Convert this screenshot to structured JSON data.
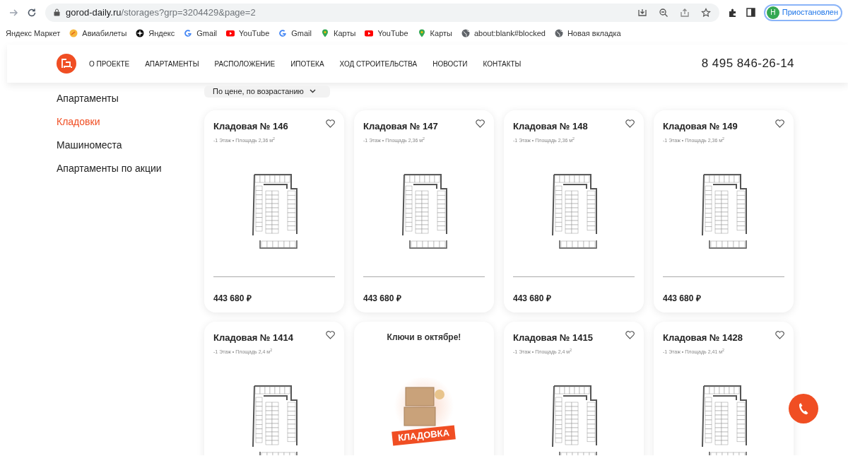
{
  "browser": {
    "url_domain": "gorod-daily.ru",
    "url_path": "/storages?grp=3204429&page=2",
    "profile_initial": "Н",
    "profile_label": "Приостановлен",
    "bookmarks": [
      {
        "label": "Яндекс Маркет",
        "kind": "none"
      },
      {
        "label": "Авиабилеты",
        "kind": "avia"
      },
      {
        "label": "Яндекс",
        "kind": "yandex"
      },
      {
        "label": "Gmail",
        "kind": "google"
      },
      {
        "label": "YouTube",
        "kind": "youtube"
      },
      {
        "label": "Gmail",
        "kind": "google"
      },
      {
        "label": "Карты",
        "kind": "maps"
      },
      {
        "label": "YouTube",
        "kind": "youtube"
      },
      {
        "label": "Карты",
        "kind": "maps"
      },
      {
        "label": "about:blank#blocked",
        "kind": "globe"
      },
      {
        "label": "Новая вкладка",
        "kind": "globe"
      }
    ]
  },
  "header": {
    "nav": [
      "О ПРОЕКТЕ",
      "АПАРТАМЕНТЫ",
      "РАСПОЛОЖЕНИЕ",
      "ИПОТЕКА",
      "ХОД СТРОИТЕЛЬСТВА",
      "НОВОСТИ",
      "КОНТАКТЫ"
    ],
    "phone": "8 495 846-26-14"
  },
  "sidebar": {
    "items": [
      {
        "label": "Апартаменты",
        "selected": false
      },
      {
        "label": "Кладовки",
        "selected": true
      },
      {
        "label": "Машиноместа",
        "selected": false
      },
      {
        "label": "Апартаменты по акции",
        "selected": false
      }
    ]
  },
  "sort": {
    "label": "По цене, по возрастанию"
  },
  "cards": [
    {
      "kind": "storage",
      "title": "Кладовая № 146",
      "subtitle": "-1 Этаж • Площадь 2,36 м$^{2}$",
      "price": "443 680 ₽"
    },
    {
      "kind": "storage",
      "title": "Кладовая № 147",
      "subtitle": "-1 Этаж • Площадь 2,36 м$^{2}$",
      "price": "443 680 ₽"
    },
    {
      "kind": "storage",
      "title": "Кладовая № 148",
      "subtitle": "-1 Этаж • Площадь 2,36 м$^{2}$",
      "price": "443 680 ₽"
    },
    {
      "kind": "storage",
      "title": "Кладовая № 149",
      "subtitle": "-1 Этаж • Площадь 2,36 м$^{2}$",
      "price": "443 680 ₽"
    },
    {
      "kind": "storage",
      "title": "Кладовая № 1414",
      "subtitle": "-1 Этаж • Площадь 2,4 м$^{2}$"
    },
    {
      "kind": "promo",
      "title": "Ключи в октябре!",
      "banner": "КЛАДОВКА"
    },
    {
      "kind": "storage",
      "title": "Кладовая № 1415",
      "subtitle": "-1 Этаж • Площадь 2,4 м$^{2}$"
    },
    {
      "kind": "storage",
      "title": "Кладовая № 1428",
      "subtitle": "-1 Этаж • Площадь 2,41 м$^{2}$"
    }
  ]
}
